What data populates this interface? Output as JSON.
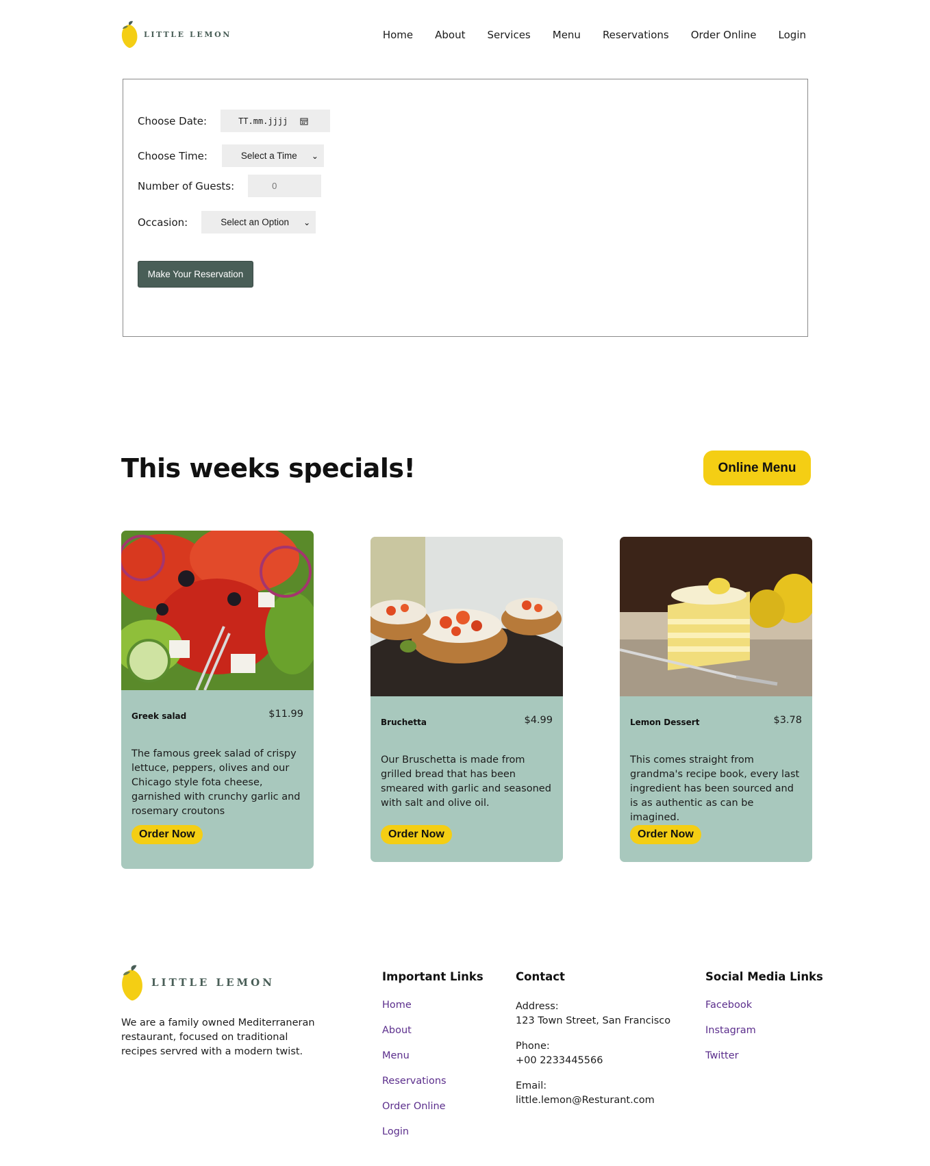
{
  "header": {
    "logo_text": "LITTLE LEMON",
    "nav": [
      "Home",
      "About",
      "Services",
      "Menu",
      "Reservations",
      "Order Online",
      "Login"
    ]
  },
  "form": {
    "date_label": "Choose Date:",
    "date_placeholder": "TT.mm.jjjj",
    "time_label": "Choose Time:",
    "time_value": "Select a Time",
    "guests_label": "Number of Guests:",
    "guests_value": "0",
    "occasion_label": "Occasion:",
    "occasion_value": "Select an Option",
    "submit_label": "Make Your Reservation"
  },
  "specials": {
    "title": "This weeks specials!",
    "menu_button": "Online Menu",
    "cards": [
      {
        "name": "Greek salad",
        "price": "$11.99",
        "description": "The famous greek salad of crispy lettuce, peppers, olives and our Chicago style fota cheese, garnished with crunchy garlic and rosemary croutons",
        "button": "Order Now"
      },
      {
        "name": "Bruchetta",
        "price": "$4.99",
        "description": "Our Bruschetta is made from grilled bread that has been smeared with garlic and seasoned with salt and olive oil.",
        "button": "Order Now"
      },
      {
        "name": "Lemon Dessert",
        "price": "$3.78",
        "description": "This comes straight from grandma's recipe book, every last ingredient has been sourced and is as authentic as can be imagined.",
        "button": "Order Now"
      }
    ]
  },
  "footer": {
    "logo_text": "LITTLE LEMON",
    "about": "We are a family owned Mediterraneran restaurant, focused on traditional recipes servred with a modern twist.",
    "important_links_title": "Important Links",
    "important_links": [
      "Home",
      "About",
      "Menu",
      "Reservations",
      "Order Online",
      "Login"
    ],
    "contact_title": "Contact",
    "address_label": "Address:",
    "address": "123 Town Street, San Francisco",
    "phone_label": "Phone:",
    "phone": "+00 2233445566",
    "email_label": "Email:",
    "email": "little.lemon@Resturant.com",
    "social_title": "Social Media Links",
    "social_links": [
      "Facebook",
      "Instagram",
      "Twitter"
    ]
  },
  "colors": {
    "primary_green": "#495e57",
    "primary_yellow": "#f4ce14",
    "card_bg": "#a8c8bd",
    "link_purple": "#5b2e8c"
  },
  "icons": {
    "logo": "lemon-icon",
    "date_picker": "calendar-icon",
    "select": "chevron-down-icon"
  }
}
